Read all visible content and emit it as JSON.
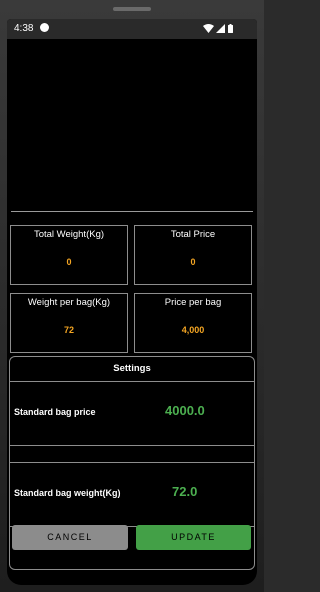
{
  "status_bar": {
    "time": "4:38"
  },
  "cards": {
    "total_weight": {
      "label": "Total Weight(Kg)",
      "value": "0"
    },
    "total_price": {
      "label": "Total Price",
      "value": "0"
    },
    "weight_per_bag": {
      "label": "Weight per bag(Kg)",
      "value": "72"
    },
    "price_per_bag": {
      "label": "Price per bag",
      "value": "4,000"
    }
  },
  "settings": {
    "title": "Settings",
    "bag_price": {
      "label": "Standard bag price",
      "value": "4000.0"
    },
    "bag_weight": {
      "label": "Standard bag weight(Kg)",
      "value": "72.0"
    }
  },
  "buttons": {
    "cancel": "CANCEL",
    "update": "UPDATE"
  },
  "colors": {
    "value_orange": "#f5a623",
    "value_green": "#4caf50",
    "update_button": "#43a047",
    "cancel_button": "#8c8c8c"
  }
}
